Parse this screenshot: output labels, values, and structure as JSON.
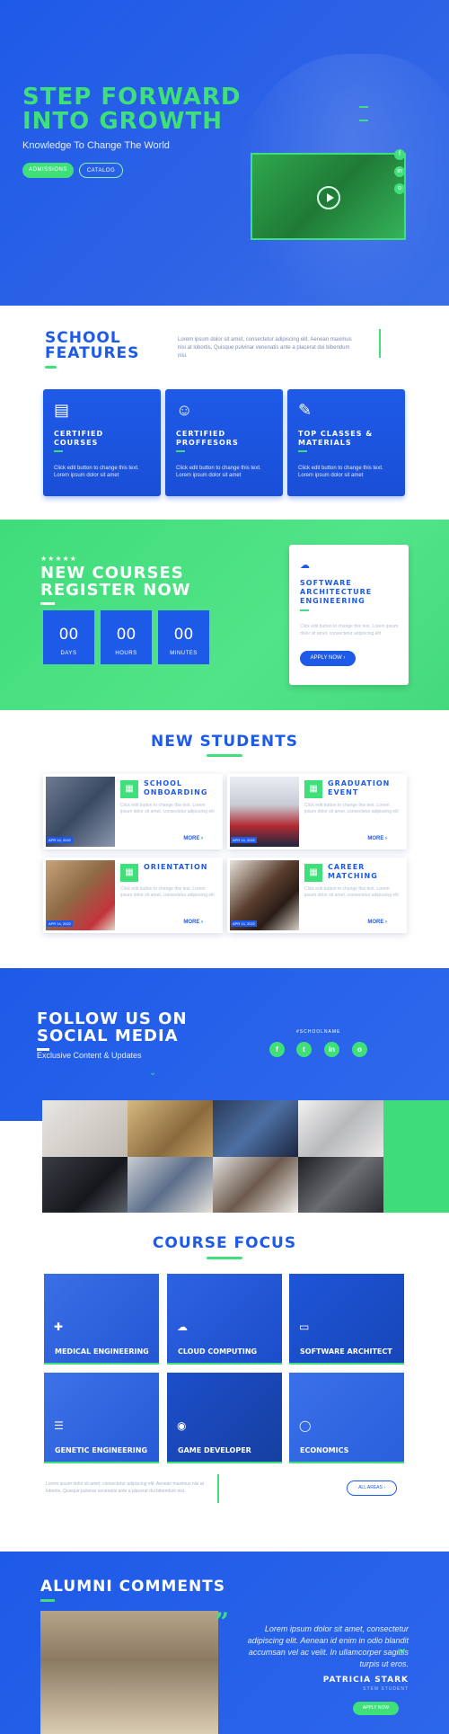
{
  "hero": {
    "title_line1": "STEP FORWARD",
    "title_line2": "INTO GROWTH",
    "subtitle": "Knowledge To Change The World",
    "btn_admissions": "ADMISSIONS",
    "btn_catalog": "CATALOG",
    "video_icon": "play-icon",
    "side_icons": [
      "f",
      "in",
      "o"
    ]
  },
  "features": {
    "title_line1": "SCHOOL",
    "title_line2": "FEATURES",
    "description": "Lorem ipsum dolor sit amet, consectetur adipiscing elit. Aenean maximus nisi at lobortis. Quisque pulvinar venenatis ante a placerat dui bibendum nisi.",
    "cards": [
      {
        "icon": "certificate-icon",
        "title_line1": "CERTIFIED",
        "title_line2": "COURSES",
        "text": "Click edit button to change this text. Lorem ipsum dolor sit amet"
      },
      {
        "icon": "professor-icon",
        "title_line1": "CERTIFIED",
        "title_line2": "PROFFESORS",
        "text": "Click edit button to change this text. Lorem ipsum dolor sit amet"
      },
      {
        "icon": "materials-icon",
        "title_line1": "TOP CLASSES &",
        "title_line2": "MATERIALS",
        "text": "Click edit button to change this text. Lorem ipsum dolor sit amet"
      }
    ]
  },
  "register": {
    "stars": "★★★★★",
    "title_line1": "NEW COURSES",
    "title_line2": "REGISTER NOW",
    "countdown": [
      {
        "value": "00",
        "label": "DAYS"
      },
      {
        "value": "00",
        "label": "HOURS"
      },
      {
        "value": "00",
        "label": "MINUTES"
      }
    ],
    "card": {
      "title_line1": "SOFTWARE",
      "title_line2": "ARCHITECTURE",
      "title_line3": "ENGINEERING",
      "text": "Click edit button to change this text. Lorem ipsum dolor sit amet, consectetur adipiscing elit",
      "apply_label": "APPLY NOW ›"
    }
  },
  "students": {
    "title": "NEW STUDENTS",
    "cards": [
      {
        "title_line1": "SCHOOL",
        "title_line2": "ONBOARDING",
        "date": "APR 14, 2022",
        "text": "Click edit button to change this text. Lorem ipsum dolor sit amet, consectetur adipiscing elit",
        "more": "MORE ›"
      },
      {
        "title_line1": "GRADUATION",
        "title_line2": "EVENT",
        "date": "APR 14, 2022",
        "text": "Click edit button to change this text. Lorem ipsum dolor sit amet, consectetur adipiscing elit",
        "more": "MORE ›"
      },
      {
        "title_line1": "ORIENTATION",
        "title_line2": "",
        "date": "APR 14, 2022",
        "text": "Click edit button to change this text. Lorem ipsum dolor sit amet, consectetur adipiscing elit",
        "more": "MORE ›"
      },
      {
        "title_line1": "CAREER",
        "title_line2": "MATCHING",
        "date": "APR 14, 2022",
        "text": "Click edit button to change this text. Lorem ipsum dolor sit amet, consectetur adipiscing elit",
        "more": "MORE ›"
      }
    ]
  },
  "social": {
    "title_line1": "FOLLOW US ON",
    "title_line2": "SOCIAL MEDIA",
    "subtitle": "Exclusive Content & Updates",
    "hashtag": "#SCHOOLNAME",
    "icons": [
      "f",
      "t",
      "in",
      "o"
    ]
  },
  "focus": {
    "title": "COURSE FOCUS",
    "cards": [
      {
        "icon": "plus-icon",
        "label": "MEDICAL ENGINEERING"
      },
      {
        "icon": "cloud-icon",
        "label": "CLOUD COMPUTING"
      },
      {
        "icon": "computer-icon",
        "label": "SOFTWARE ARCHITECT"
      },
      {
        "icon": "sliders-icon",
        "label": "GENETIC ENGINEERING"
      },
      {
        "icon": "gamepad-icon",
        "label": "GAME DEVELOPER"
      },
      {
        "icon": "chat-icon",
        "label": "ECONOMICS"
      }
    ],
    "description": "Lorem ipsum dolor sit amet, consectetur adipiscing elit. Aenean maximus nisi at lobortis. Quisque pulvinar venenatis ante a placerat dui bibendum nisi.",
    "all_areas": "ALL AREAS ›"
  },
  "alumni": {
    "title": "ALUMNI COMMENTS",
    "quote": "Lorem ipsum dolor sit amet, consectetur adipiscing elit. Aenean id enim in odio blandit accumsan vel ac velit. In ullamcorper sagittis turpis ut eros.",
    "name": "PATRICIA STARK",
    "role": "STEM STUDENT",
    "apply_label": "APPLY NOW"
  },
  "colors": {
    "primary_blue": "#1e5ae8",
    "accent_green": "#3fe07a"
  }
}
